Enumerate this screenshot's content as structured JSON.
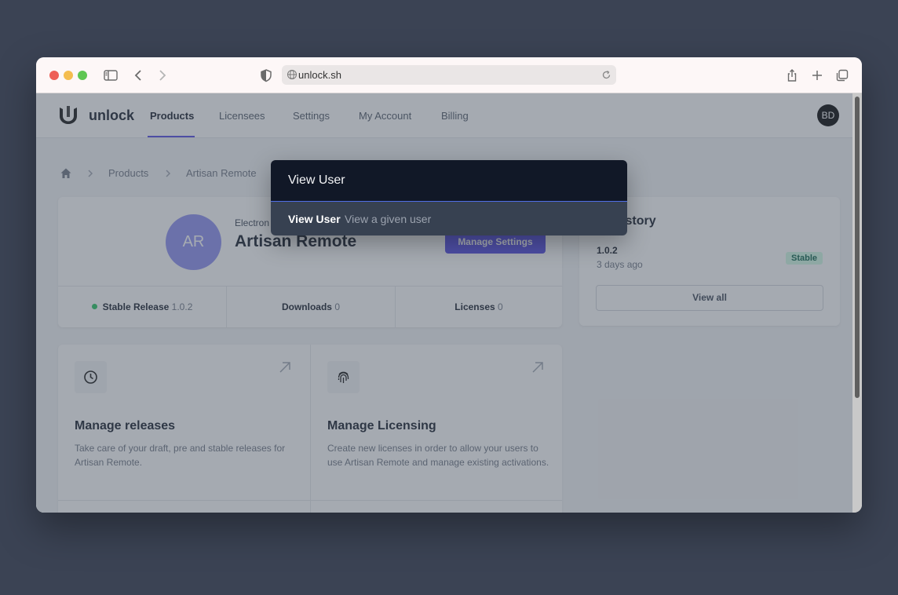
{
  "browser": {
    "url": "unlock.sh"
  },
  "nav": {
    "brand": "unlock",
    "links": [
      "Products",
      "Licensees",
      "Settings",
      "My Account",
      "Billing"
    ],
    "user_initials": "BD"
  },
  "breadcrumb": [
    "Products",
    "Artisan Remote"
  ],
  "product": {
    "initials": "AR",
    "type": "Electron",
    "name": "Artisan Remote",
    "manage_button": "Manage Settings",
    "stats": [
      {
        "label": "Stable Release",
        "value": "1.0.2"
      },
      {
        "label": "Downloads",
        "value": "0"
      },
      {
        "label": "Licenses",
        "value": "0"
      }
    ]
  },
  "release_history": {
    "title": "se history",
    "version": "1.0.2",
    "date": "3 days ago",
    "badge": "Stable",
    "view_all": "View all"
  },
  "actions": [
    {
      "title": "Manage releases",
      "description": "Take care of your draft, pre and stable releases for Artisan Remote."
    },
    {
      "title": "Manage Licensing",
      "description": "Create new licenses in order to allow your users to use Artisan Remote and manage existing activations."
    }
  ],
  "palette": {
    "input_value": "View User",
    "result_title": "View User",
    "result_description": "View a given user"
  },
  "colors": {
    "accent": "#4f46e5",
    "overlay": "#4b5563",
    "palette_bg": "#111827",
    "status_green": "#22c55e"
  }
}
